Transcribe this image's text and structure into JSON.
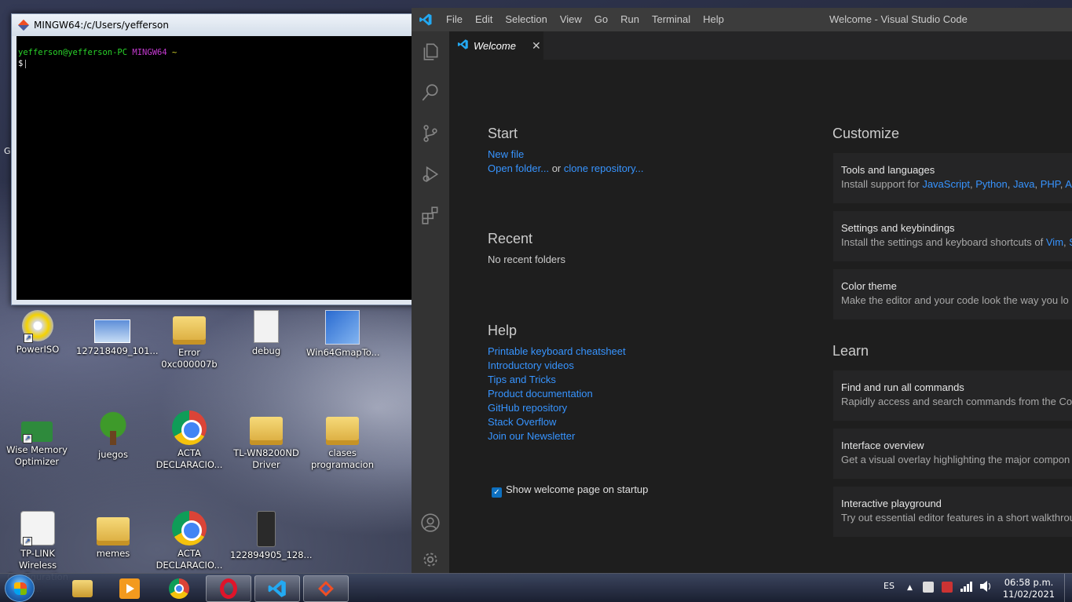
{
  "desktop": {
    "icons": [
      {
        "label": "PowerISO"
      },
      {
        "label": "127218409_101..."
      },
      {
        "label": "Error 0xc000007b"
      },
      {
        "label": "debug"
      },
      {
        "label": "Win64GmapTo..."
      },
      {
        "label": "Wise Memory Optimizer"
      },
      {
        "label": "juegos"
      },
      {
        "label": "ACTA DECLARACIO..."
      },
      {
        "label": "TL-WN8200ND Driver"
      },
      {
        "label": "clases programacion"
      },
      {
        "label": "TP-LINK Wireless Configuration ..."
      },
      {
        "label": "memes"
      },
      {
        "label": "ACTA DECLARACIO..."
      },
      {
        "label": "122894905_128..."
      }
    ],
    "stray_label": "G"
  },
  "terminal": {
    "title": "MINGW64:/c/Users/yefferson",
    "prompt_user": "yefferson@yefferson-PC",
    "prompt_env": "MINGW64",
    "prompt_path": "~",
    "prompt_symbol": "$"
  },
  "vscode": {
    "menu": [
      "File",
      "Edit",
      "Selection",
      "View",
      "Go",
      "Run",
      "Terminal",
      "Help"
    ],
    "window_title": "Welcome - Visual Studio Code",
    "tab_label": "Welcome",
    "accent": "#3794ff",
    "start": {
      "heading": "Start",
      "new_file": "New file",
      "open_folder": "Open folder...",
      "or": "or",
      "clone_repo": "clone repository..."
    },
    "recent": {
      "heading": "Recent",
      "empty": "No recent folders"
    },
    "help": {
      "heading": "Help",
      "links": [
        "Printable keyboard cheatsheet",
        "Introductory videos",
        "Tips and Tricks",
        "Product documentation",
        "GitHub repository",
        "Stack Overflow",
        "Join our Newsletter"
      ]
    },
    "startup_checkbox": {
      "label": "Show welcome page on startup",
      "checked": true
    },
    "customize": {
      "heading": "Customize",
      "cards": [
        {
          "title": "Tools and languages",
          "desc_prefix": "Install support for ",
          "links": [
            "JavaScript",
            "Python",
            "Java",
            "PHP",
            "Azu"
          ]
        },
        {
          "title": "Settings and keybindings",
          "desc_prefix": "Install the settings and keyboard shortcuts of ",
          "links": [
            "Vim",
            "S"
          ]
        },
        {
          "title": "Color theme",
          "desc_prefix": "Make the editor and your code look the way you lo",
          "links": []
        }
      ]
    },
    "learn": {
      "heading": "Learn",
      "cards": [
        {
          "title": "Find and run all commands",
          "desc": "Rapidly access and search commands from the Com"
        },
        {
          "title": "Interface overview",
          "desc": "Get a visual overlay highlighting the major compon"
        },
        {
          "title": "Interactive playground",
          "desc": "Try out essential editor features in a short walkthrou"
        }
      ]
    }
  },
  "taskbar": {
    "language": "ES",
    "time": "06:58 p.m.",
    "date": "11/02/2021",
    "pinned": [
      "explorer-icon",
      "media-player-icon",
      "chrome-icon",
      "opera-icon",
      "vscode-icon",
      "git-icon"
    ]
  }
}
